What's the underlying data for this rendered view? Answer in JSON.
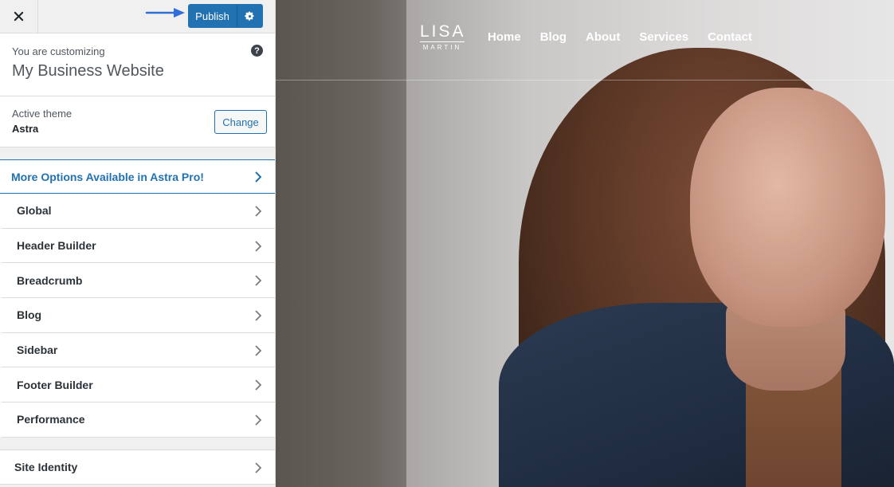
{
  "topbar": {
    "close_icon": "close-icon",
    "publish_label": "Publish",
    "settings_icon": "gear-icon"
  },
  "info": {
    "label": "You are customizing",
    "site_title": "My Business Website",
    "help_icon": "?"
  },
  "theme": {
    "label": "Active theme",
    "name": "Astra",
    "change_label": "Change"
  },
  "pro": {
    "label": "More Options Available in Astra Pro!"
  },
  "sections": [
    {
      "label": "Global"
    },
    {
      "label": "Header Builder"
    },
    {
      "label": "Breadcrumb"
    },
    {
      "label": "Blog"
    },
    {
      "label": "Sidebar"
    },
    {
      "label": "Footer Builder"
    },
    {
      "label": "Performance"
    }
  ],
  "site_identity": {
    "label": "Site Identity"
  },
  "preview": {
    "logo_main": "LISA",
    "logo_sub": "MARTIN",
    "nav": [
      "Home",
      "Blog",
      "About",
      "Services",
      "Contact"
    ]
  },
  "colors": {
    "accent": "#2271b1",
    "sidebar_bg": "#f0f0f1"
  }
}
